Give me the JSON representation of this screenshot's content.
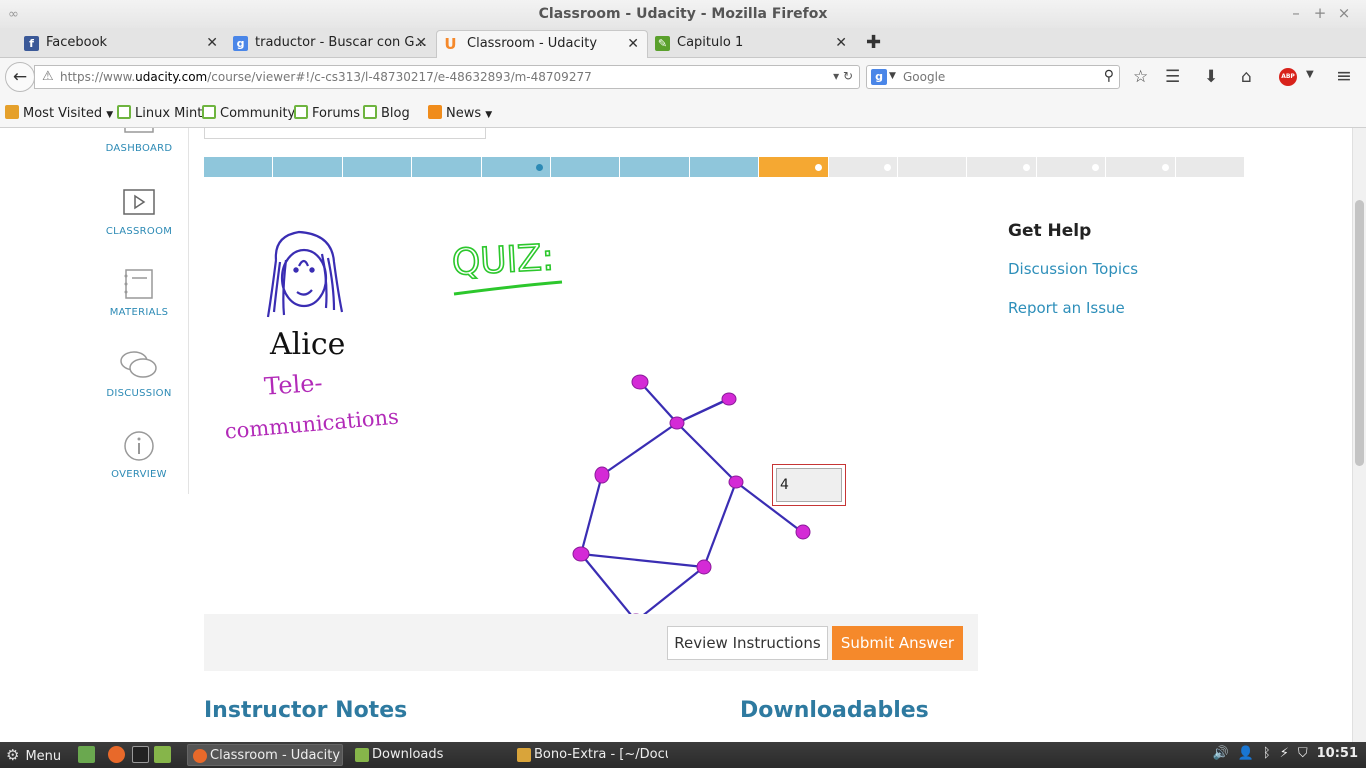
{
  "window": {
    "title": "Classroom - Udacity - Mozilla Firefox"
  },
  "tabs": [
    {
      "label": "Facebook",
      "icon": "facebook-icon",
      "color": "#3b5998"
    },
    {
      "label": "traductor - Buscar con G...",
      "icon": "google-icon",
      "color": "#4a86e8"
    },
    {
      "label": "Classroom - Udacity",
      "icon": "udacity-icon",
      "color": "#f5892b"
    },
    {
      "label": "Capitulo 1",
      "icon": "document-icon",
      "color": "#5aa02c"
    }
  ],
  "navbar": {
    "url_prefix": "https://www.",
    "url_domain": "udacity.com",
    "url_path": "/course/viewer#!/c-cs313/l-48730217/e-48632893/m-48709277",
    "search_placeholder": "Google"
  },
  "bookmarks": [
    {
      "label": "Most Visited",
      "icon": "folder-icon",
      "has_dropdown": true
    },
    {
      "label": "Linux Mint",
      "icon": "mint-icon"
    },
    {
      "label": "Community",
      "icon": "mint-icon"
    },
    {
      "label": "Forums",
      "icon": "mint-icon"
    },
    {
      "label": "Blog",
      "icon": "mint-icon"
    },
    {
      "label": "News",
      "icon": "rss-icon",
      "has_dropdown": true
    }
  ],
  "sidebar": {
    "items": [
      {
        "label": "DASHBOARD",
        "icon": "dashboard-icon"
      },
      {
        "label": "CLASSROOM",
        "icon": "play-icon"
      },
      {
        "label": "MATERIALS",
        "icon": "notebook-icon"
      },
      {
        "label": "DISCUSSION",
        "icon": "speech-bubbles-icon"
      },
      {
        "label": "OVERVIEW",
        "icon": "info-icon"
      }
    ]
  },
  "progress": {
    "total_segments": 15,
    "completed_segments": 8,
    "current_segment": 9,
    "colors": {
      "done": "#8fc6db",
      "current": "#f5a832",
      "todo": "#e9e9e9"
    }
  },
  "quiz": {
    "heading_handwritten": "QUIZ:",
    "person_name": "Alice",
    "person_role_line1": "Tele-",
    "person_role_line2": "communications",
    "answer_value": "4"
  },
  "actions": {
    "review_label": "Review Instructions",
    "submit_label": "Submit Answer"
  },
  "sections": {
    "instructor_notes": "Instructor Notes",
    "downloadables": "Downloadables"
  },
  "help": {
    "heading": "Get Help",
    "links": [
      "Discussion Topics",
      "Report an Issue"
    ]
  },
  "taskbar": {
    "menu_label": "Menu",
    "tasks": [
      {
        "label": "Classroom - Udacity -...",
        "active": true
      },
      {
        "label": "Downloads",
        "active": false
      },
      {
        "label": "Bono-Extra - [~/Docu...",
        "active": false
      }
    ],
    "clock": "10:51"
  }
}
